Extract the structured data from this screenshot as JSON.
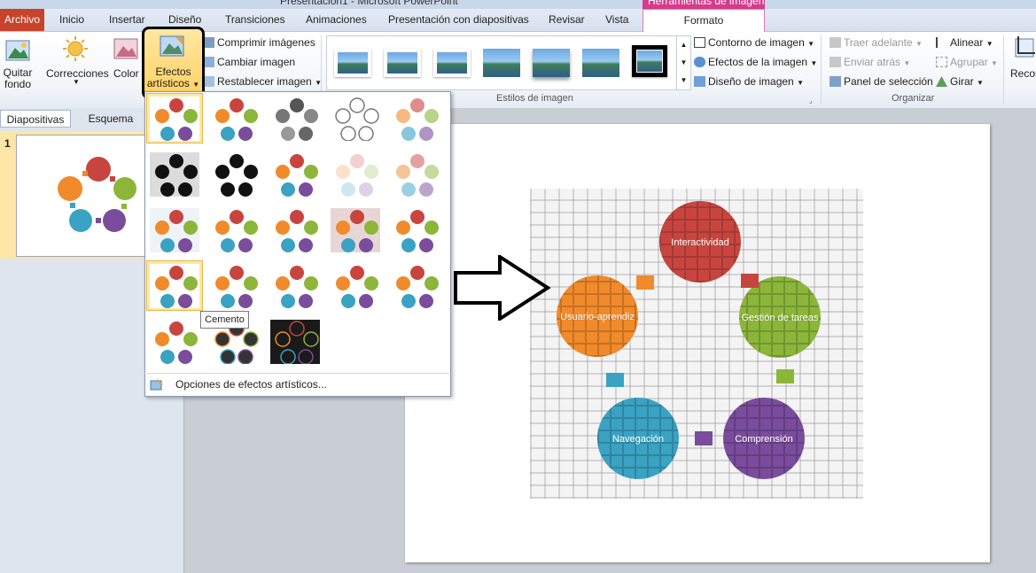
{
  "window": {
    "title": "Presentación1 - Microsoft PowerPoint",
    "context_tools": "Herramientas de imagen"
  },
  "tabs": [
    "Archivo",
    "Inicio",
    "Insertar",
    "Diseño",
    "Transiciones",
    "Animaciones",
    "Presentación con diapositivas",
    "Revisar",
    "Vista",
    "Formato"
  ],
  "ribbon": {
    "quitar_fondo": "Quitar\nfondo",
    "correcciones": "Correcciones",
    "color": "Color",
    "efectos_line1": "Efectos",
    "efectos_line2": "artísticos",
    "comprimir": "Comprimir imágenes",
    "cambiar": "Cambiar imagen",
    "restablecer": "Restablecer imagen",
    "styles_group": "Estilos de imagen",
    "contorno": "Contorno de imagen",
    "efectos_imagen": "Efectos de la imagen",
    "diseno_imagen": "Diseño de imagen",
    "traer": "Traer adelante",
    "enviar": "Enviar atrás",
    "panel": "Panel de selección",
    "alinear": "Alinear",
    "agrupar": "Agrupar",
    "girar": "Girar",
    "organizar_group": "Organizar",
    "recortar": "Recor"
  },
  "pane": {
    "tab1": "Diapositivas",
    "tab2": "Esquema",
    "slide_number": "1"
  },
  "gallery": {
    "options_label": "Opciones de efectos artísticos...",
    "tooltip": "Cemento"
  },
  "diagram": {
    "items": [
      {
        "label": "Interactividad",
        "color": "#c8453f"
      },
      {
        "label": "Gestión de tareas",
        "color": "#8bb63a"
      },
      {
        "label": "Comprensión",
        "color": "#7a4c9c"
      },
      {
        "label": "Navegación",
        "color": "#3aa2c2"
      },
      {
        "label": "Usuario-aprendiz",
        "color": "#f08a2b"
      }
    ],
    "arrow_color": "#f08a2b"
  }
}
